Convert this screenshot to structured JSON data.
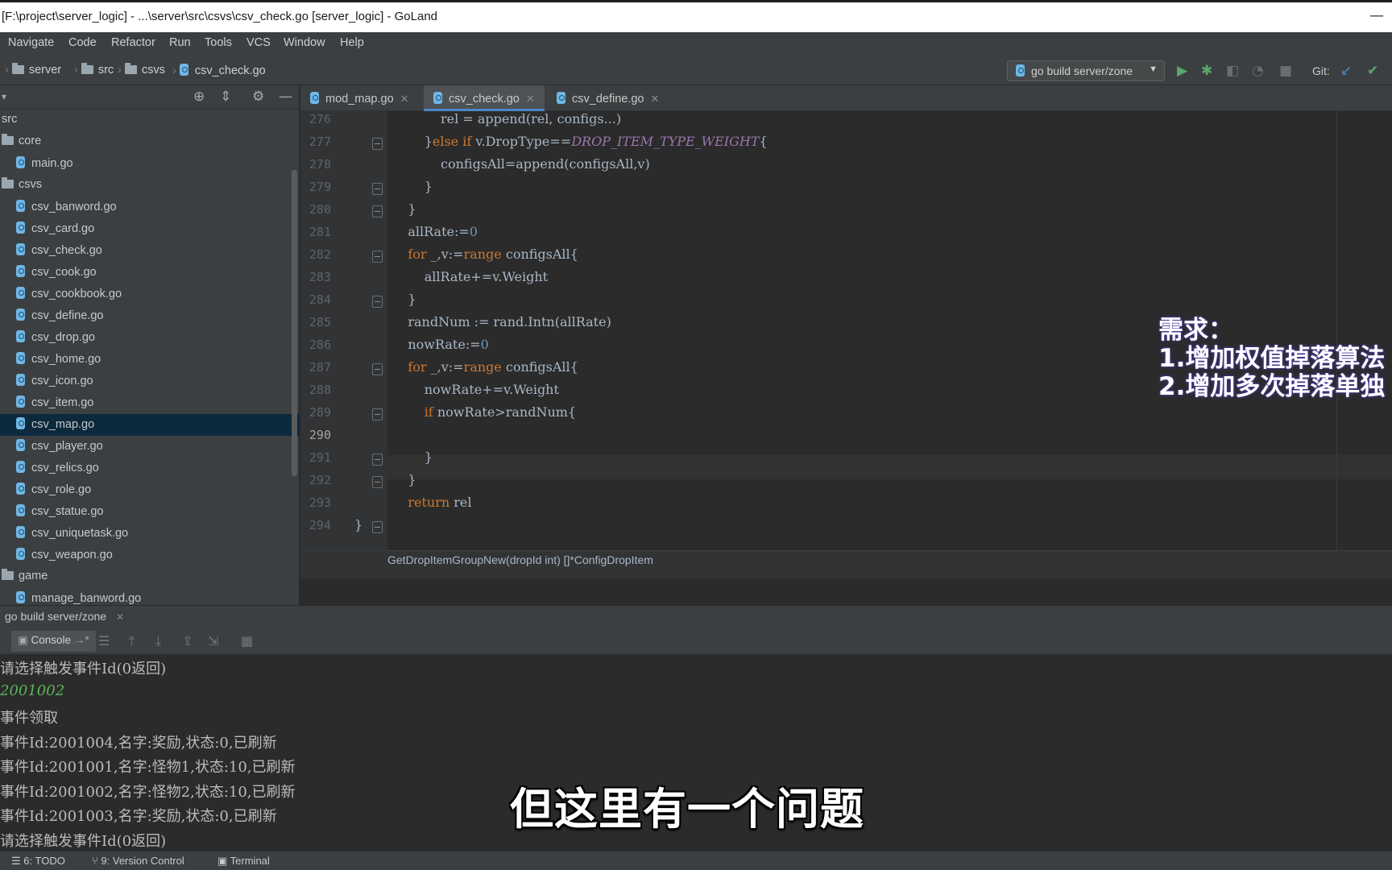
{
  "window": {
    "title": "[F:\\project\\server_logic] - ...\\server\\src\\csvs\\csv_check.go [server_logic] - GoLand"
  },
  "menu": [
    "Navigate",
    "Code",
    "Refactor",
    "Run",
    "Tools",
    "VCS",
    "Window",
    "Help"
  ],
  "breadcrumb": [
    "server",
    "src",
    "csvs",
    "csv_check.go"
  ],
  "toolbar": {
    "run_config": "go build server/zone",
    "git_label": "Git:"
  },
  "project_tree": [
    {
      "label": "src",
      "icon": "none"
    },
    {
      "label": "core",
      "icon": "folder"
    },
    {
      "label": "main.go",
      "icon": "go-file"
    },
    {
      "label": "csvs",
      "icon": "folder"
    },
    {
      "label": "csv_banword.go",
      "icon": "go-file"
    },
    {
      "label": "csv_card.go",
      "icon": "go-file"
    },
    {
      "label": "csv_check.go",
      "icon": "go-file"
    },
    {
      "label": "csv_cook.go",
      "icon": "go-file"
    },
    {
      "label": "csv_cookbook.go",
      "icon": "go-file"
    },
    {
      "label": "csv_define.go",
      "icon": "go-file"
    },
    {
      "label": "csv_drop.go",
      "icon": "go-file"
    },
    {
      "label": "csv_home.go",
      "icon": "go-file"
    },
    {
      "label": "csv_icon.go",
      "icon": "go-file"
    },
    {
      "label": "csv_item.go",
      "icon": "go-file"
    },
    {
      "label": "csv_map.go",
      "icon": "go-file",
      "selected": true
    },
    {
      "label": "csv_player.go",
      "icon": "go-file"
    },
    {
      "label": "csv_relics.go",
      "icon": "go-file"
    },
    {
      "label": "csv_role.go",
      "icon": "go-file"
    },
    {
      "label": "csv_statue.go",
      "icon": "go-file"
    },
    {
      "label": "csv_uniquetask.go",
      "icon": "go-file"
    },
    {
      "label": "csv_weapon.go",
      "icon": "go-file"
    },
    {
      "label": "game",
      "icon": "folder"
    },
    {
      "label": "manage_banword.go",
      "icon": "go-file"
    }
  ],
  "editor_tabs": [
    {
      "label": "mod_map.go",
      "active": false
    },
    {
      "label": "csv_check.go",
      "active": true
    },
    {
      "label": "csv_define.go",
      "active": false
    }
  ],
  "code_lines": [
    {
      "n": "276",
      "text": "        rel = append(rel, configs...)"
    },
    {
      "n": "277",
      "text": "    }else if v.DropType==DROP_ITEM_TYPE_WEIGHT{"
    },
    {
      "n": "278",
      "text": "        configsAll=append(configsAll,v)"
    },
    {
      "n": "279",
      "text": "    }"
    },
    {
      "n": "280",
      "text": "}"
    },
    {
      "n": "281",
      "text": "allRate:=0"
    },
    {
      "n": "282",
      "text": "for _,v:=range configsAll{"
    },
    {
      "n": "283",
      "text": "    allRate+=v.Weight"
    },
    {
      "n": "284",
      "text": "}"
    },
    {
      "n": "285",
      "text": "randNum := rand.Intn(allRate)"
    },
    {
      "n": "286",
      "text": "nowRate:=0"
    },
    {
      "n": "287",
      "text": "for _,v:=range configsAll{"
    },
    {
      "n": "288",
      "text": "    nowRate+=v.Weight"
    },
    {
      "n": "289",
      "text": "    if nowRate>randNum{"
    },
    {
      "n": "290",
      "text": ""
    },
    {
      "n": "291",
      "text": "    }"
    },
    {
      "n": "292",
      "text": "}"
    },
    {
      "n": "293",
      "text": "return rel"
    },
    {
      "n": "294",
      "text": "}"
    }
  ],
  "function_breadcrumb": "GetDropItemGroupNew(dropId int) []*ConfigDropItem",
  "annotation": {
    "heading": "需求：",
    "line1": "1.增加权值掉落算法",
    "line2": "2.增加多次掉落单独"
  },
  "run_panel": {
    "tab_label": "go build server/zone",
    "console_label": "Console"
  },
  "console_lines": [
    {
      "text": "请选择触发事件Id(0返回)",
      "type": "output"
    },
    {
      "text": "2001002",
      "type": "input"
    },
    {
      "text": "事件领取",
      "type": "output"
    },
    {
      "text": "事件Id:2001004,名字:奖励,状态:0,已刷新",
      "type": "output"
    },
    {
      "text": "事件Id:2001001,名字:怪物1,状态:10,已刷新",
      "type": "output"
    },
    {
      "text": "事件Id:2001002,名字:怪物2,状态:10,已刷新",
      "type": "output"
    },
    {
      "text": "事件Id:2001003,名字:奖励,状态:0,已刷新",
      "type": "output"
    },
    {
      "text": "请选择触发事件Id(0返回)",
      "type": "output"
    }
  ],
  "subtitle": "但这里有一个问题",
  "statusbar": {
    "todo": "6: TODO",
    "vcs": "9: Version Control",
    "terminal": "Terminal"
  },
  "colors": {
    "keyword": "#cc7832",
    "number": "#6897bb",
    "constant": "#9876aa",
    "selection": "#0d293e",
    "accent": "#4a88c7"
  }
}
